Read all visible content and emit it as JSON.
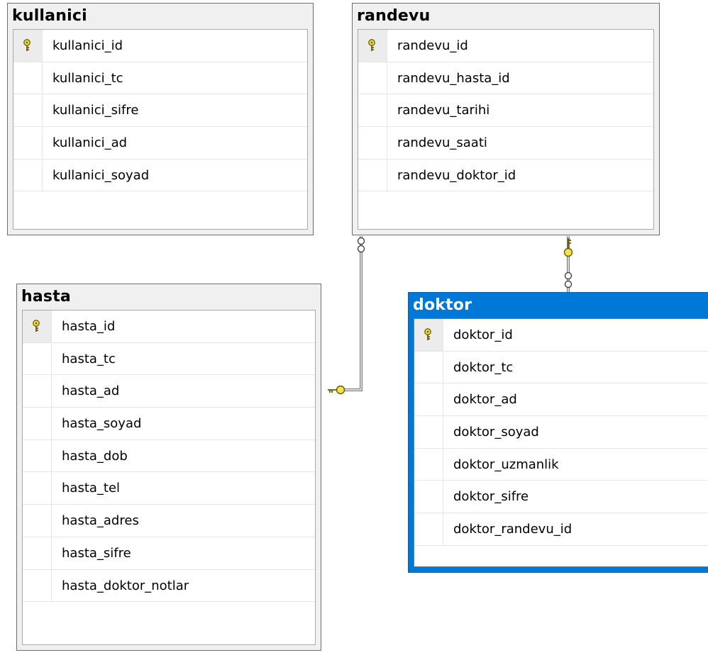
{
  "tables": {
    "kullanici": {
      "name": "kullanici",
      "columns": [
        "kullanici_id",
        "kullanici_tc",
        "kullanici_sifre",
        "kullanici_ad",
        "kullanici_soyad"
      ]
    },
    "randevu": {
      "name": "randevu",
      "columns": [
        "randevu_id",
        "randevu_hasta_id",
        "randevu_tarihi",
        "randevu_saati",
        "randevu_doktor_id"
      ]
    },
    "hasta": {
      "name": "hasta",
      "columns": [
        "hasta_id",
        "hasta_tc",
        "hasta_ad",
        "hasta_soyad",
        "hasta_dob",
        "hasta_tel",
        "hasta_adres",
        "hasta_sifre",
        "hasta_doktor_notlar"
      ]
    },
    "doktor": {
      "name": "doktor",
      "columns": [
        "doktor_id",
        "doktor_tc",
        "doktor_ad",
        "doktor_soyad",
        "doktor_uzmanlik",
        "doktor_sifre",
        "doktor_randevu_id"
      ]
    }
  },
  "selected_table": "doktor",
  "relationships": [
    {
      "from": "randevu",
      "to": "hasta",
      "from_end": "many",
      "to_end": "one"
    },
    {
      "from": "doktor",
      "to": "randevu",
      "from_end": "many",
      "to_end": "one"
    }
  ],
  "colors": {
    "selection": "#0078d7",
    "primary_key_icon": "#e8d200",
    "relationship_line": "#808080"
  }
}
